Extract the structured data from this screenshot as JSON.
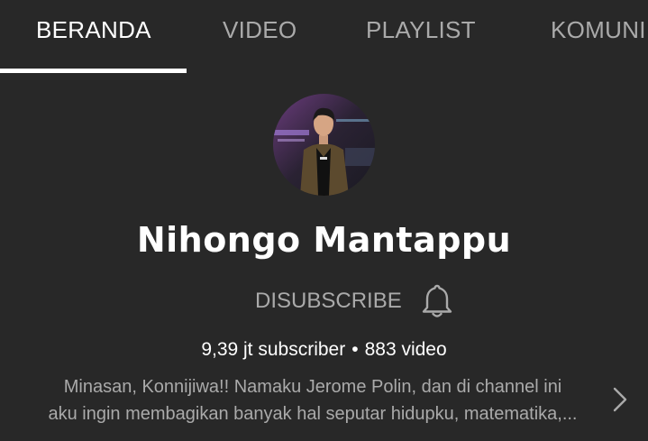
{
  "tabs": [
    {
      "label": "BERANDA",
      "active": true
    },
    {
      "label": "VIDEO",
      "active": false
    },
    {
      "label": "PLAYLIST",
      "active": false
    },
    {
      "label": "KOMUNI",
      "active": false
    }
  ],
  "channel": {
    "name": "Nihongo Mantappu",
    "unsubscribe_label": "DISUBSCRIBE",
    "subscribers": "9,39 jt subscriber",
    "separator": "•",
    "videos": "883 video",
    "description_line1": "Minasan, Konnijiwa!! Namaku Jerome Polin, dan di channel ini",
    "description_line2": "aku ingin membagikan banyak hal seputar hidupku, matematika,..."
  },
  "icons": {
    "notification": "bell-icon",
    "expand": "chevron-right-icon"
  },
  "colors": {
    "background": "#282828",
    "active_tab": "#ffffff",
    "inactive_tab": "#aaaaaa",
    "secondary_text": "#aaaaaa"
  }
}
